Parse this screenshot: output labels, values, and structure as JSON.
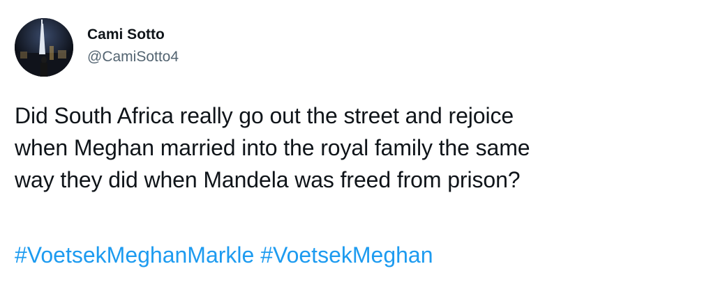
{
  "tweet": {
    "author": {
      "display_name": "Cami Sotto",
      "handle": "@CamiSotto4"
    },
    "text_lines": [
      "Did South Africa really go out the street and rejoice",
      "when Meghan married into the royal family the same",
      "way they did when Mandela was freed from prison?"
    ],
    "hashtags": [
      "#VoetsekMeghanMarkle",
      "#VoetsekMeghan"
    ],
    "colors": {
      "text": "#0f1419",
      "secondary_text": "#536471",
      "link": "#1d9bf0",
      "background": "#ffffff"
    }
  }
}
